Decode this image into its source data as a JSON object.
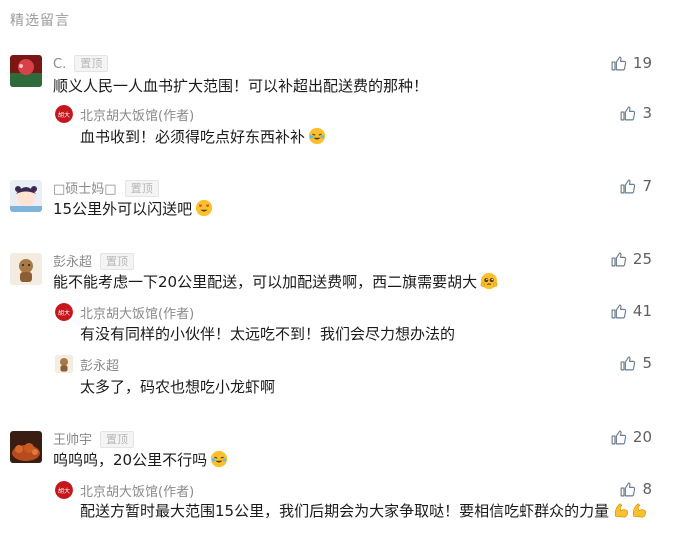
{
  "section_title": "精选留言",
  "pin_label": "置顶",
  "comments": [
    {
      "name": "C.",
      "likes": "19",
      "text": "顺义人民一人血书扩大范围！可以补超出配送费的那种！",
      "replies": [
        {
          "name": "北京胡大饭馆(作者)",
          "likes": "3",
          "text": "血书收到！必须得吃点好东西补补"
        }
      ]
    },
    {
      "name": "□硕士妈□",
      "likes": "7",
      "text": "15公里外可以闪送吧",
      "replies": []
    },
    {
      "name": "彭永超",
      "likes": "25",
      "text": "能不能考虑一下20公里配送，可以加配送费啊，西二旗需要胡大",
      "replies": [
        {
          "name": "北京胡大饭馆(作者)",
          "likes": "41",
          "text": "有没有同样的小伙伴！太远吃不到！我们会尽力想办法的"
        },
        {
          "name": "彭永超",
          "likes": "5",
          "text": "太多了，码农也想吃小龙虾啊"
        }
      ]
    },
    {
      "name": "王帅宇",
      "likes": "20",
      "text": "呜呜呜，20公里不行吗",
      "replies": [
        {
          "name": "北京胡大饭馆(作者)",
          "likes": "8",
          "text": "配送方暂时最大范围15公里，我们后期会为大家争取哒！要相信吃虾群众的力量"
        }
      ]
    }
  ],
  "author_avatar_text": "胡大",
  "icons": {
    "like": "thumbs-up-icon"
  },
  "colors": {
    "brand_red": "#c4161c",
    "name_gray": "#8a8a8a",
    "text": "#1a1a1a"
  }
}
